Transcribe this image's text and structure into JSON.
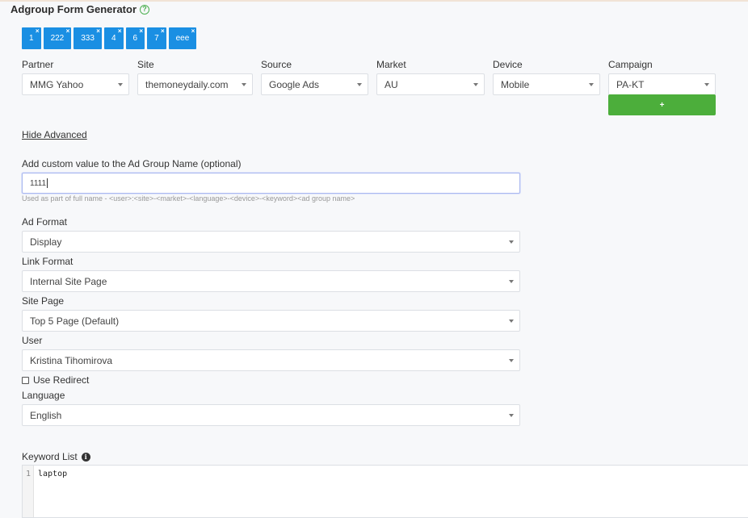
{
  "app": {
    "title": "Adgroup Form Generator",
    "help_icon": "question-circle-icon"
  },
  "tags": [
    "1",
    "222",
    "333",
    "4",
    "6",
    "7",
    "eee"
  ],
  "tag_remove_glyph": "×",
  "fields": {
    "partner": {
      "label": "Partner",
      "value": "MMG Yahoo"
    },
    "site": {
      "label": "Site",
      "value": "themoneydaily.com"
    },
    "source": {
      "label": "Source",
      "value": "Google Ads"
    },
    "market": {
      "label": "Market",
      "value": "AU"
    },
    "device": {
      "label": "Device",
      "value": "Mobile"
    },
    "campaign": {
      "label": "Campaign",
      "value": "PA-KT"
    }
  },
  "add_button": {
    "label": "+"
  },
  "advanced_toggle": "Hide Advanced",
  "custom_value": {
    "label": "Add custom value to the Ad Group Name (optional)",
    "value": "1111",
    "hint": "Used as part of full name - <user>:<site>-<market>-<language>-<device>-<keyword><ad group name>"
  },
  "ad_format": {
    "label": "Ad Format",
    "value": "Display"
  },
  "link_format": {
    "label": "Link Format",
    "value": "Internal Site Page"
  },
  "site_page": {
    "label": "Site Page",
    "value": "Top 5 Page (Default)"
  },
  "user": {
    "label": "User",
    "value": "Kristina Tihomirova"
  },
  "use_redirect": {
    "label": "Use Redirect",
    "checked": false
  },
  "language": {
    "label": "Language",
    "value": "English"
  },
  "keyword_list": {
    "label": "Keyword List",
    "info_icon": "info-circle-icon",
    "lines": [
      {
        "number": "1",
        "text": "laptop"
      }
    ]
  },
  "colors": {
    "tag_bg": "#1a8fe3",
    "add_button_bg": "#4cae3b",
    "help_icon": "#4caf50",
    "focus_border": "#aab8ef"
  }
}
